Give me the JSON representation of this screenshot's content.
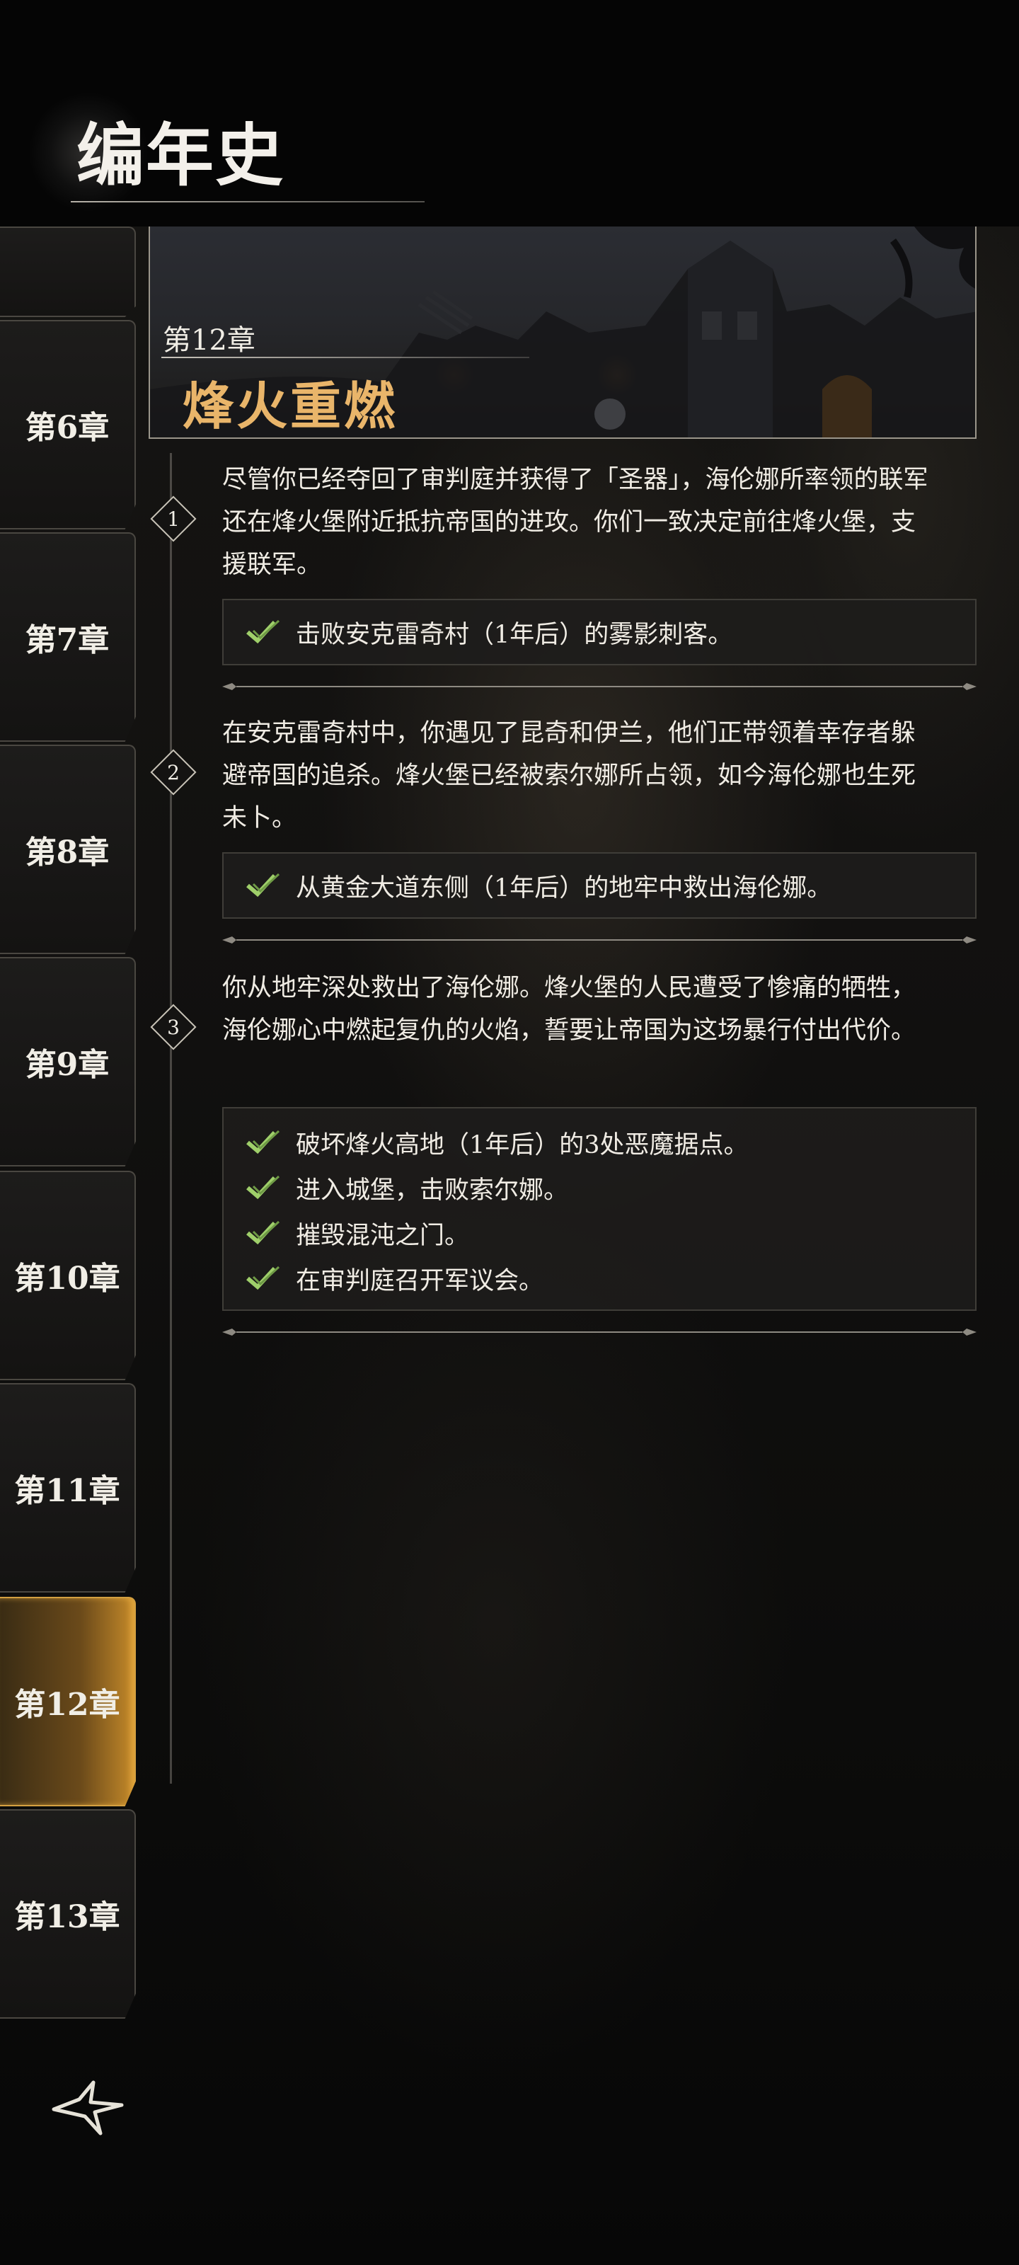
{
  "header": {
    "title": "编年史"
  },
  "sidebar": {
    "tabs": [
      {
        "label": "第6章",
        "active": false
      },
      {
        "label": "第7章",
        "active": false
      },
      {
        "label": "第8章",
        "active": false
      },
      {
        "label": "第9章",
        "active": false
      },
      {
        "label": "第10章",
        "active": false
      },
      {
        "label": "第11章",
        "active": false
      },
      {
        "label": "第12章",
        "active": true
      },
      {
        "label": "第13章",
        "active": false
      }
    ]
  },
  "chapter": {
    "number": "第12章",
    "title": "烽火重燃",
    "steps": [
      {
        "index": "1",
        "text": "尽管你已经夺回了审判庭并获得了「圣器」，海伦娜所率领的联军还在烽火堡附近抵抗帝国的进攻。你们一致决定前往烽火堡，支援联军。",
        "objectives": [
          "击败安克雷奇村（1年后）的雾影刺客。"
        ]
      },
      {
        "index": "2",
        "text": "在安克雷奇村中，你遇见了昆奇和伊兰，他们正带领着幸存者躲避帝国的追杀。烽火堡已经被索尔娜所占领，如今海伦娜也生死未卜。",
        "objectives": [
          "从黄金大道东侧（1年后）的地牢中救出海伦娜。"
        ]
      },
      {
        "index": "3",
        "text": "你从地牢深处救出了海伦娜。烽火堡的人民遭受了惨痛的牺牲，海伦娜心中燃起复仇的火焰，誓要让帝国为这场暴行付出代价。",
        "objectives": [
          "破坏烽火高地（1年后）的3处恶魔据点。",
          "进入城堡，击败索尔娜。",
          "摧毁混沌之门。",
          "在审判庭召开军议会。"
        ]
      }
    ]
  },
  "colors": {
    "accent_gold": "#e9b56a",
    "check_green": "#9fcf6a",
    "active_tab": "#c58a2a"
  },
  "icons": {
    "check": "check-icon",
    "diamond": "step-diamond-icon",
    "logo": "game-logo-icon"
  }
}
